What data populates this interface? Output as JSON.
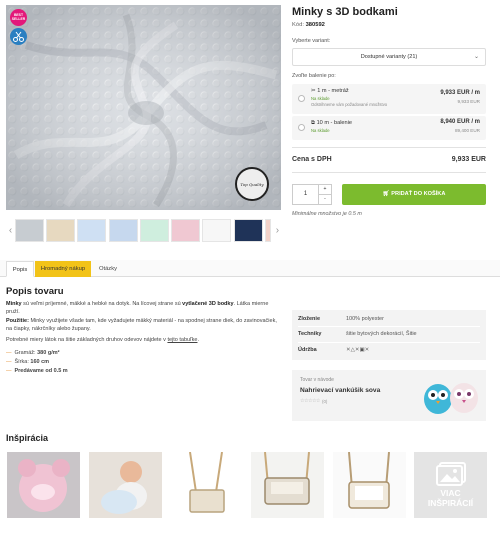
{
  "product": {
    "title": "Minky s 3D bodkami",
    "code_label": "Kód:",
    "code": "380592",
    "badge_best": "BEST SELLER",
    "seal_text": "Top Quality"
  },
  "variant": {
    "label": "Vyberte variant:",
    "selected": "Dostupné varianty (21)"
  },
  "packaging": {
    "label": "Zvoľte balenie po:",
    "options": [
      {
        "name": "1 m - metráž",
        "stock": "Na sklade",
        "note": "Odstrihneme vám požadované množstvo",
        "price": "9,933 EUR / m",
        "sub": "9,933 EUR"
      },
      {
        "name": "10 m - balenie",
        "stock": "Na sklade",
        "note": "",
        "price": "8,940 EUR / m",
        "sub": "89,400 EUR"
      }
    ]
  },
  "total": {
    "label": "Cena s DPH",
    "price": "9,933 EUR"
  },
  "cart": {
    "qty": "1",
    "plus": "+",
    "minus": "-",
    "add_label": "PRIDAŤ DO KOŠÍKA",
    "min_note": "Minimálne množstvo je 0.5 m"
  },
  "thumb_colors": [
    "#c7ccd1",
    "#e7d9c0",
    "#cfe0f3",
    "#c6d8ee",
    "#cfeede",
    "#f0c8d2",
    "#f7f7f7",
    "#1f3358",
    "#f2d2c9"
  ],
  "tabs": [
    "Popis",
    "Hromadný nákup",
    "Otázky"
  ],
  "description": {
    "title": "Popis tovaru",
    "p1_brand": "Minky",
    "p1_text": " sú veľmi príjemné, mäkké a hebké na dotyk. Na lícovej strane sú ",
    "p1_bold": "vytlačené 3D bodky",
    "p1_end": ". Látka mierne pruží.",
    "p2_label": "Použitie:",
    "p2_text": " Minky využijete všade tam, kde vyžadujete mäkký materiál - na spodnej strane diek, do zavinovačiek, na čiapky, nákrčníky alebo župany.",
    "p3_text": "Potrebné miery látok na šitie základných druhov odevov nájdete v ",
    "p3_link": "tejto tabuľke",
    "p3_end": ".",
    "bullets": [
      {
        "label": "Gramáž: ",
        "value": "380 g/m²"
      },
      {
        "label": "Šírka: ",
        "value": "160 cm"
      },
      {
        "label": "",
        "value": "Predávame od 0.5 m"
      }
    ]
  },
  "params": [
    {
      "key": "Zloženie",
      "value": "100% polyester"
    },
    {
      "key": "Techniky",
      "value": "šitie bytových dekorácií, Šitie"
    },
    {
      "key": "Údržba",
      "value": "⨯△⨯▣⨯"
    }
  ],
  "guide": {
    "label": "Tovar v návode",
    "title": "Nahrievací vankúšik sova",
    "stars": "☆☆☆☆☆",
    "rating": "(0)"
  },
  "inspiration": {
    "title": "Inšpirácia",
    "more_line1": "VIAC",
    "more_line2": "INŠPIRÁCIÍ"
  },
  "colors": {
    "accent_green": "#7cbb2e",
    "tab_yellow": "#f2c318",
    "badge_pink": "#e3187a",
    "stock_green": "#5a9a2d"
  }
}
